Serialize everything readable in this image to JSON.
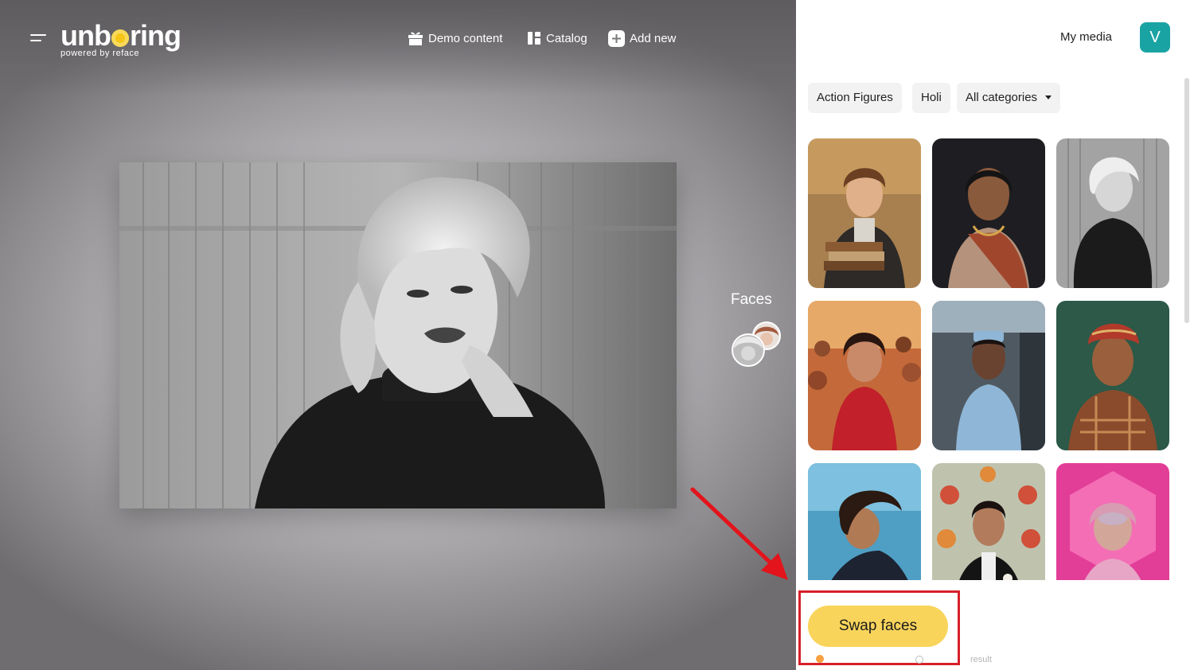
{
  "app": {
    "logo_text_before": "unb",
    "logo_text_after": "ring",
    "logo_sub": "powered by reface"
  },
  "nav": {
    "demo_content": "Demo content",
    "catalog": "Catalog",
    "add_new": "Add new"
  },
  "header": {
    "my_media": "My media",
    "avatar_letter": "V"
  },
  "categories": {
    "chip1": "Action Figures",
    "chip2": "Holi",
    "all": "All categories"
  },
  "faces": {
    "label": "Faces"
  },
  "actions": {
    "swap_faces": "Swap faces",
    "hint_right": "result"
  },
  "colors": {
    "accent_yellow": "#f9d45b",
    "avatar_teal": "#1aa3a3",
    "highlight_red": "#d7202a"
  }
}
